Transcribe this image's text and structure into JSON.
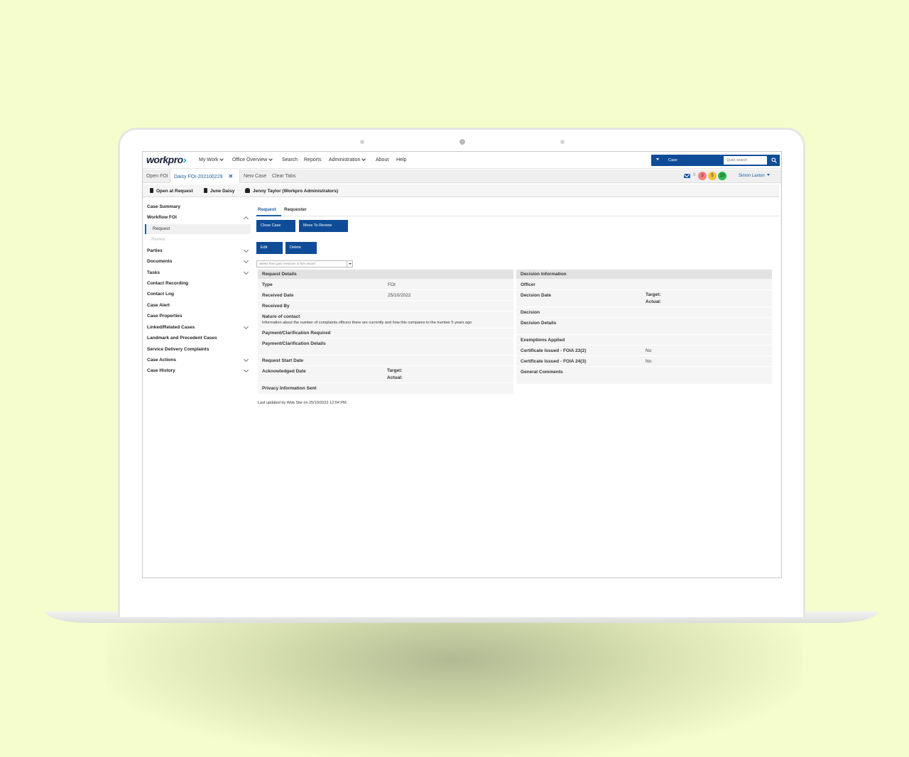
{
  "app": {
    "logo_text": "workpro",
    "nav": [
      {
        "label": "My Work",
        "dropdown": true
      },
      {
        "label": "Office Overview",
        "dropdown": true
      },
      {
        "label": "Search",
        "dropdown": false
      },
      {
        "label": "Reports",
        "dropdown": false
      },
      {
        "label": "Administration",
        "dropdown": true
      },
      {
        "label": "About",
        "dropdown": false
      },
      {
        "label": "Help",
        "dropdown": false
      }
    ],
    "search": {
      "type_label": "Case",
      "placeholder": "Quick search"
    }
  },
  "tabs": {
    "items": [
      "Open FOI",
      "Daisy FOI-202100229",
      "New Case",
      "Clear Tabs"
    ],
    "active_index": 1,
    "close_symbol": "✕"
  },
  "toolbar": {
    "mail_count": "0",
    "badges": [
      {
        "value": "3",
        "color": "#f47f7f"
      },
      {
        "value": "5",
        "color": "#f5c13b"
      },
      {
        "value": "10",
        "color": "#2db84d"
      }
    ],
    "user": "Simon Laxton"
  },
  "infobar": {
    "status": "Open at Request",
    "contact": "June Daisy",
    "owner": "Jenny Taylor (Workpro Administrators)"
  },
  "sidebar": {
    "items": [
      {
        "label": "Case Summary"
      },
      {
        "label": "Workflow FOI"
      },
      {
        "label": "Parties"
      },
      {
        "label": "Documents"
      },
      {
        "label": "Tasks"
      },
      {
        "label": "Contact Recording"
      },
      {
        "label": "Contact Log"
      },
      {
        "label": "Case Alert"
      },
      {
        "label": "Case Properties"
      },
      {
        "label": "Linked/Related Cases"
      },
      {
        "label": "Landmark and Precedent Cases"
      },
      {
        "label": "Service Delivery Complaints"
      },
      {
        "label": "Case Actions"
      },
      {
        "label": "Case History"
      }
    ],
    "workflow_steps": [
      "Request",
      "Review"
    ]
  },
  "main": {
    "subtabs": [
      "Request",
      "Requester"
    ],
    "buttons": {
      "close_case": "Close Case",
      "move_to_review": "Move To Review",
      "edit": "Edit",
      "delete": "Delete"
    },
    "revision_placeholder": "Select from past revisions of this record",
    "request_details": {
      "title": "Request Details",
      "type_label": "Type",
      "type_value": "FOI",
      "received_date_label": "Received Date",
      "received_date_value": "25/10/2022",
      "received_by_label": "Received By",
      "nature_label": "Nature of contact",
      "nature_value": "Information about the number of complaints officers there are currently and how this compares to the number 5 years ago",
      "payment_required_label": "Payment/Clarification Required",
      "payment_details_label": "Payment/Clarification Details",
      "request_start_label": "Request Start Date",
      "acknowledged_label": "Acknowledged Date",
      "target_label": "Target:",
      "actual_label": "Actual:",
      "privacy_label": "Privacy Information Sent"
    },
    "decision_info": {
      "title": "Decision Information",
      "officer_label": "Officer",
      "decision_date_label": "Decision Date",
      "target_label": "Target:",
      "actual_label": "Actual:",
      "decision_label": "Decision",
      "decision_details_label": "Decision Details",
      "exemptions_label": "Exemptions Applied",
      "cert_23_label": "Certificate Issued - FOIA 23(2)",
      "cert_23_value": "No",
      "cert_24_label": "Certificate Issued - FOIA 24(3)",
      "cert_24_value": "No",
      "comments_label": "General Comments"
    },
    "last_updated": "Last updated by Web Site on 25/10/2022 12:54 PM."
  }
}
